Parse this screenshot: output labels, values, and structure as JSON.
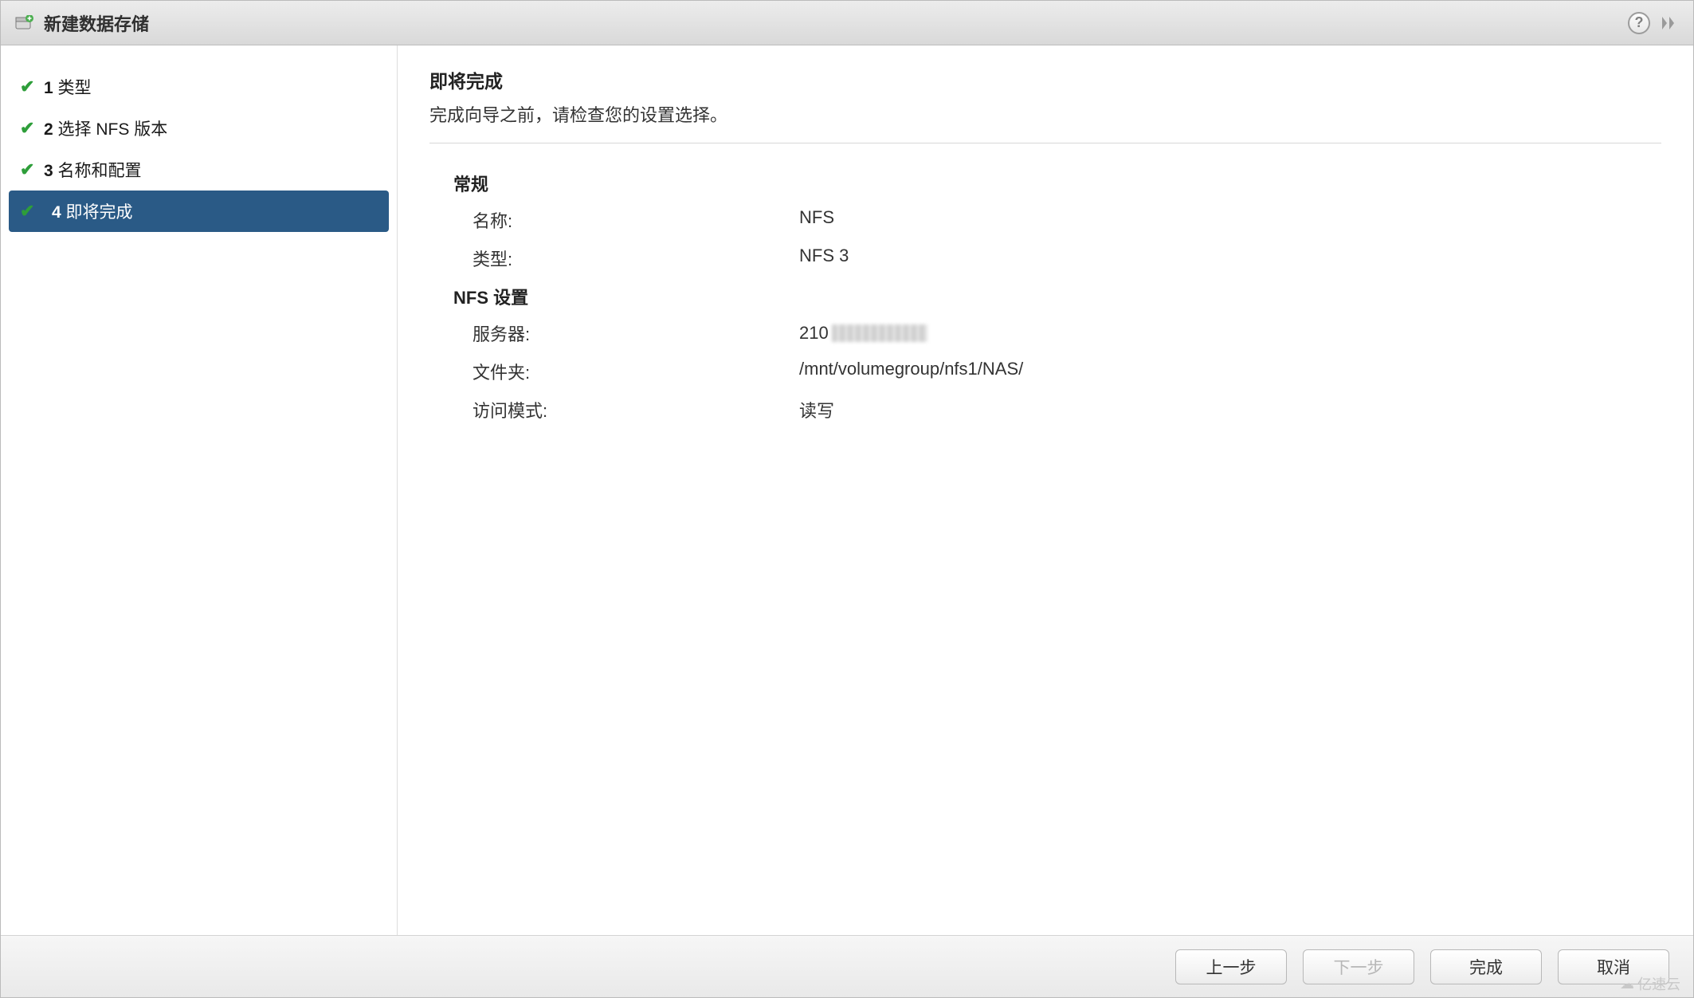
{
  "titlebar": {
    "title": "新建数据存储",
    "datastore_icon": "datastore-add-icon",
    "help_icon": "help-icon",
    "popout_icon": "popout-icon"
  },
  "sidebar": {
    "steps": [
      {
        "num": "1",
        "label": "类型",
        "completed": true,
        "active": false
      },
      {
        "num": "2",
        "label": "选择 NFS 版本",
        "completed": true,
        "active": false
      },
      {
        "num": "3",
        "label": "名称和配置",
        "completed": true,
        "active": false
      },
      {
        "num": "4",
        "label": "即将完成",
        "completed": true,
        "active": true
      }
    ]
  },
  "content": {
    "heading": "即将完成",
    "subheading": "完成向导之前，请检查您的设置选择。",
    "sections": [
      {
        "title": "常规",
        "rows": [
          {
            "k": "名称:",
            "v": "NFS"
          },
          {
            "k": "类型:",
            "v": "NFS 3"
          }
        ]
      },
      {
        "title": "NFS 设置",
        "rows": [
          {
            "k": "服务器:",
            "v": "210",
            "masked": true
          },
          {
            "k": "文件夹:",
            "v": "/mnt/volumegroup/nfs1/NAS/"
          },
          {
            "k": "访问模式:",
            "v": "读写"
          }
        ]
      }
    ]
  },
  "footer": {
    "back": "上一步",
    "next": "下一步",
    "finish": "完成",
    "cancel": "取消"
  },
  "watermark": {
    "text": "亿速云"
  }
}
